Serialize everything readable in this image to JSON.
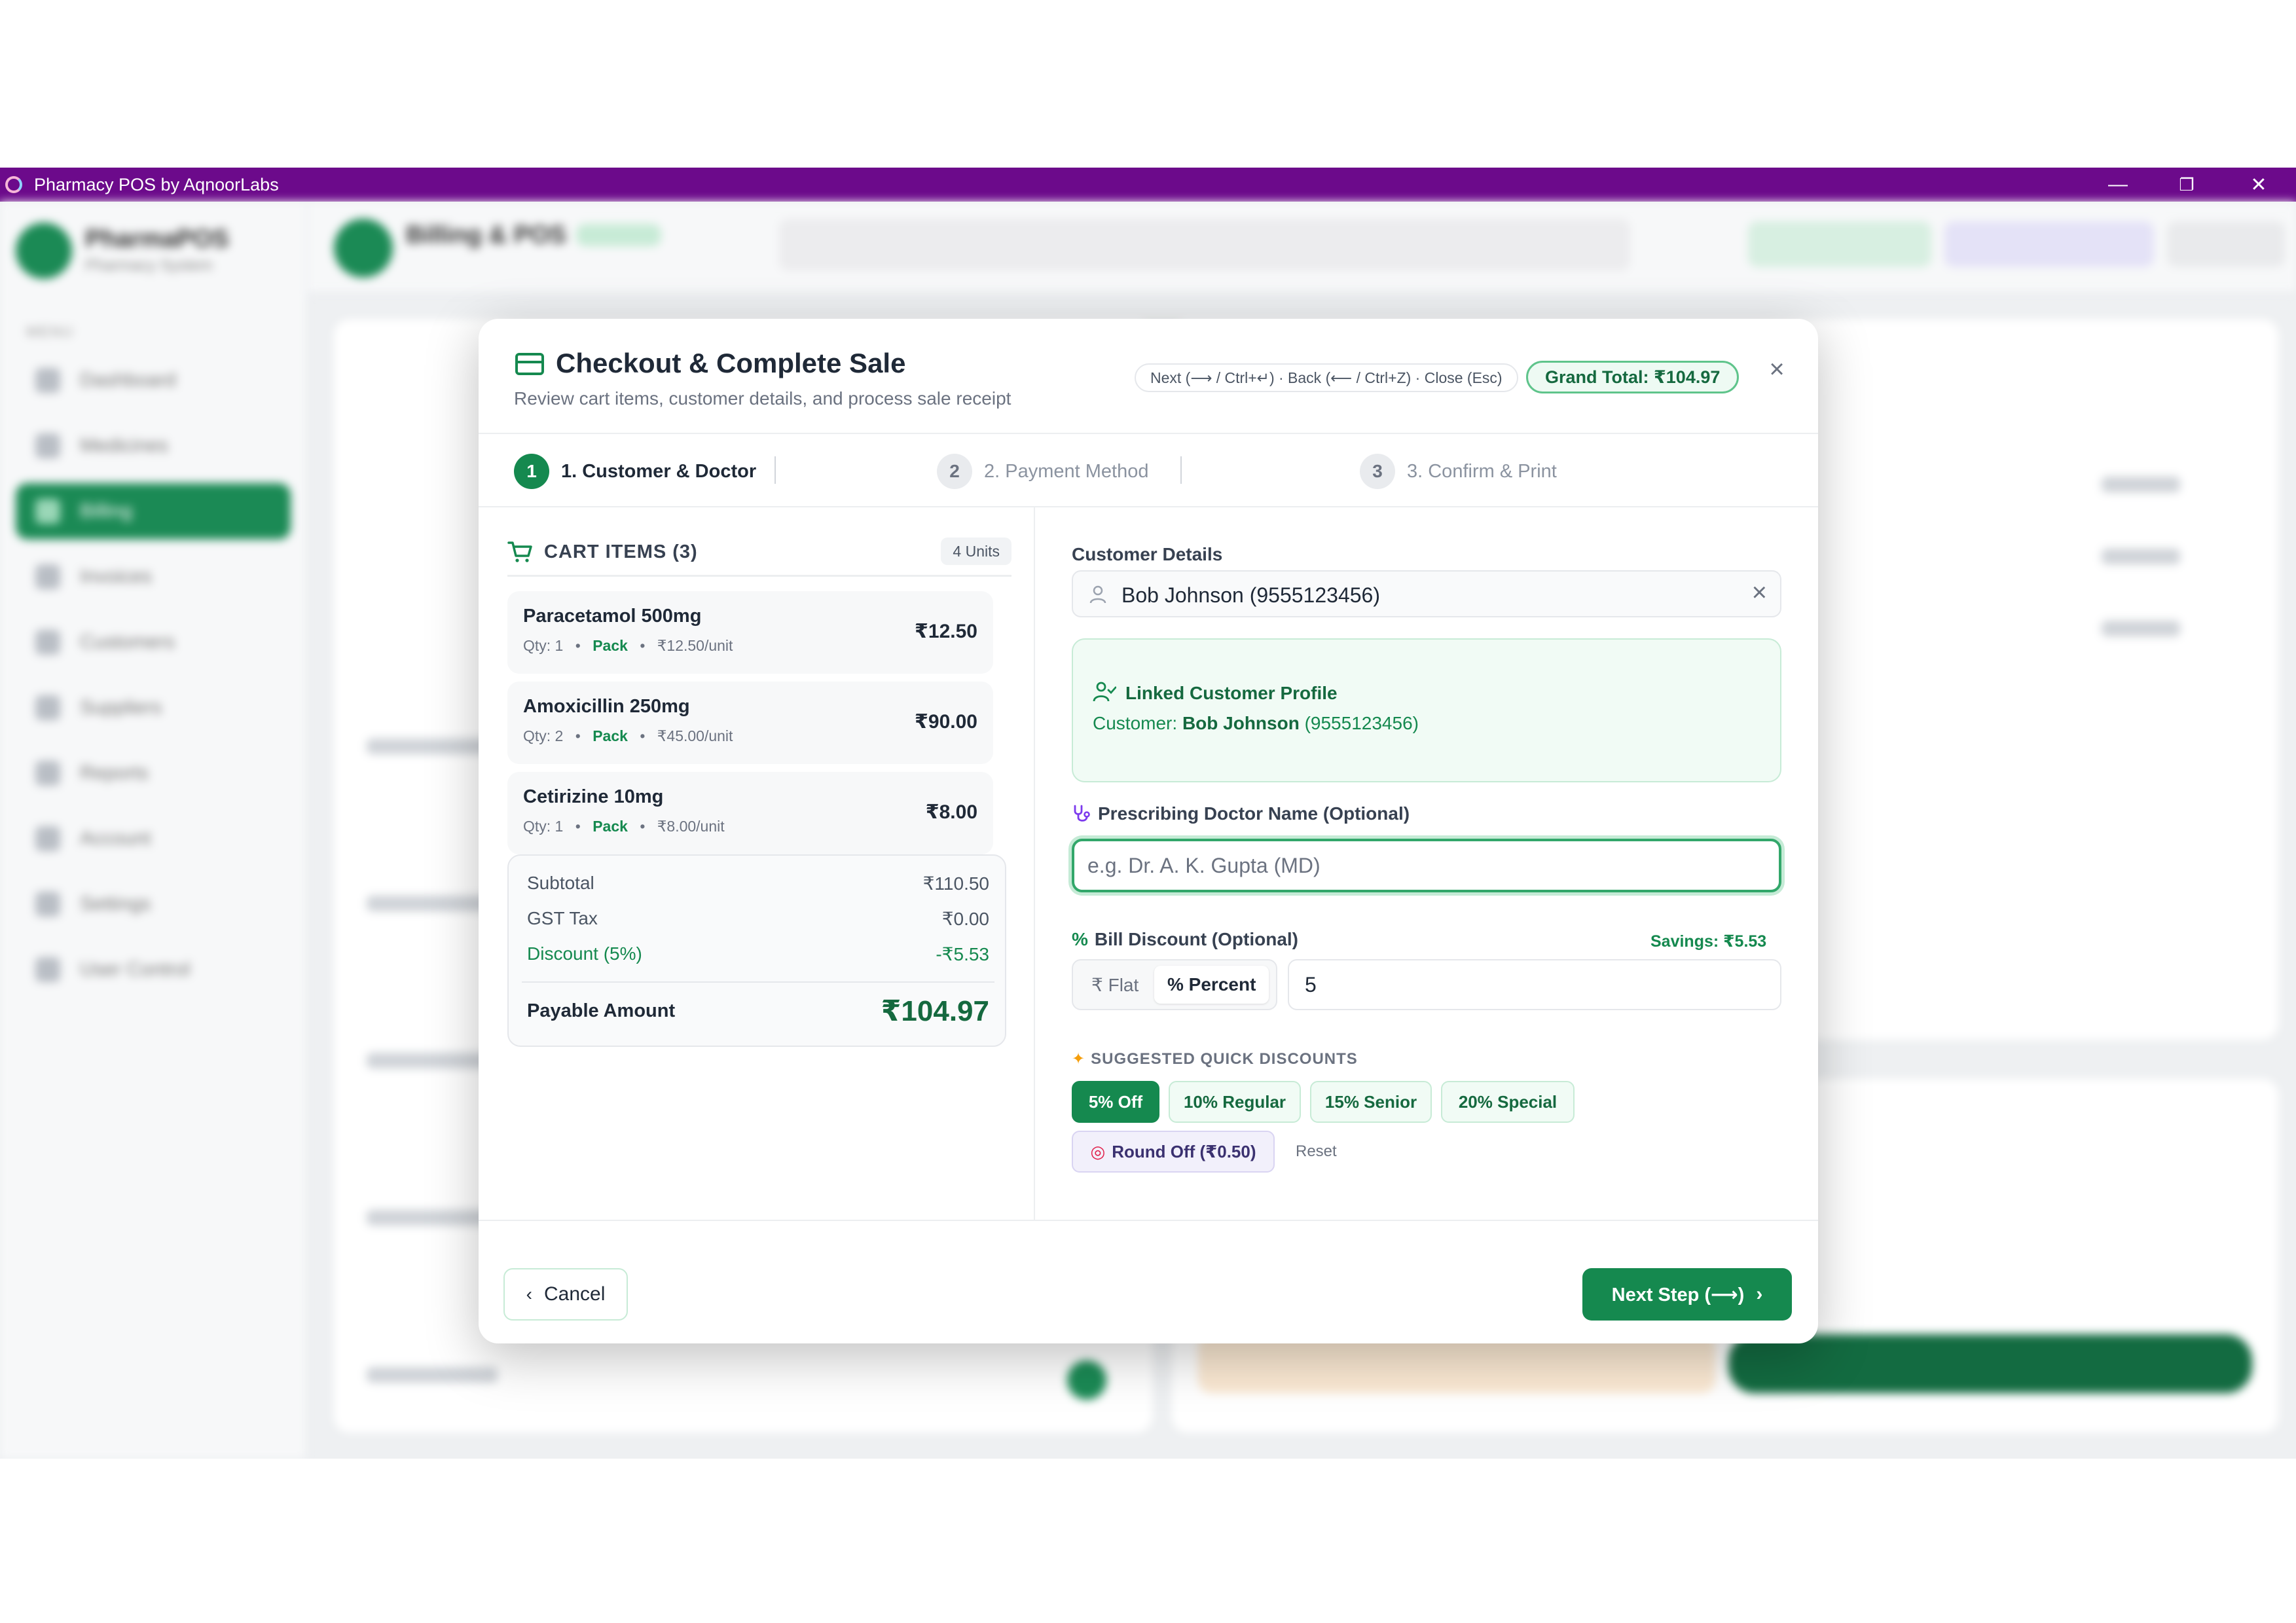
{
  "window": {
    "title": "Pharmacy POS by AqnoorLabs",
    "controls": {
      "minimize": "—",
      "restore": "❐",
      "close": "✕"
    }
  },
  "background": {
    "sidebar": {
      "brand": "PharmaPOS",
      "subtitle": "Pharmacy System",
      "menu_label": "MENU",
      "items": [
        "Dashboard",
        "Medicines",
        "Billing",
        "Invoices",
        "Customers",
        "Suppliers",
        "Reports",
        "Account",
        "Settings",
        "User Control"
      ]
    },
    "header": {
      "title": "Billing & POS"
    }
  },
  "modal": {
    "title": "Checkout & Complete Sale",
    "subtitle": "Review cart items, customer details, and process sale receipt",
    "shortcuts": "Next (⟶ / Ctrl+↵) · Back (⟵ / Ctrl+Z) · Close (Esc)",
    "grand_total": "Grand Total: ₹104.97",
    "close_icon": "×",
    "steps": [
      {
        "num": "1",
        "label": "1. Customer & Doctor",
        "active": true
      },
      {
        "num": "2",
        "label": "2. Payment Method",
        "active": false
      },
      {
        "num": "3",
        "label": "3. Confirm & Print",
        "active": false
      }
    ],
    "cart": {
      "title": "CART ITEMS (3)",
      "units": "4 Units",
      "items": [
        {
          "name": "Paracetamol 500mg",
          "qty": "Qty: 1",
          "pack": "Pack",
          "unit_price": "₹12.50/unit",
          "price": "₹12.50"
        },
        {
          "name": "Amoxicillin 250mg",
          "qty": "Qty: 2",
          "pack": "Pack",
          "unit_price": "₹45.00/unit",
          "price": "₹90.00"
        },
        {
          "name": "Cetirizine 10mg",
          "qty": "Qty: 1",
          "pack": "Pack",
          "unit_price": "₹8.00/unit",
          "price": "₹8.00"
        }
      ],
      "dot": "•"
    },
    "summary": {
      "subtotal_label": "Subtotal",
      "subtotal": "₹110.50",
      "gst_label": "GST Tax",
      "gst": "₹0.00",
      "discount_label": "Discount (5%)",
      "discount": "-₹5.53",
      "payable_label": "Payable Amount",
      "payable": "₹104.97"
    },
    "customer": {
      "section_label": "Customer Details",
      "value": "Bob Johnson (9555123456)",
      "clear_icon": "×",
      "linked_title": "Linked Customer Profile",
      "linked_prefix": "Customer: ",
      "linked_name": "Bob Johnson",
      "linked_phone": " (9555123456)"
    },
    "doctor": {
      "label": "Prescribing Doctor Name (Optional)",
      "placeholder": "e.g. Dr. A. K. Gupta (MD)",
      "value": ""
    },
    "discount": {
      "label": "Bill Discount (Optional)",
      "savings": "Savings: ₹5.53",
      "flat_label": "₹ Flat",
      "percent_label": "% Percent",
      "mode": "percent",
      "value": "5",
      "quick_label": "SUGGESTED QUICK DISCOUNTS",
      "chips": [
        "5% Off",
        "10% Regular",
        "15% Senior",
        "20% Special"
      ],
      "active_chip": "5% Off",
      "round_off": "Round Off (₹0.50)",
      "reset": "Reset"
    },
    "footer": {
      "cancel": "Cancel",
      "next": "Next Step (⟶)"
    }
  },
  "colors": {
    "title_bar": "#6c0a8b",
    "accent_green": "#15894f",
    "dark_green": "#15693f",
    "light_green_bg": "#f1fbf5"
  }
}
